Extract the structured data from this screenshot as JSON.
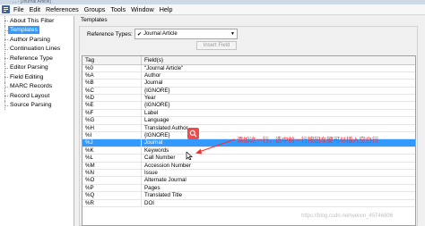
{
  "titlebar": {
    "text": "... - [Journal Article]"
  },
  "menu": {
    "items": [
      "File",
      "Edit",
      "References",
      "Groups",
      "Tools",
      "Window",
      "Help"
    ]
  },
  "sidebar": {
    "items": [
      {
        "label": "About This Filter",
        "selected": false
      },
      {
        "label": "Templates",
        "selected": true
      },
      {
        "label": "Author Parsing",
        "selected": false
      },
      {
        "label": "Continuation Lines",
        "selected": false
      },
      {
        "label": "Reference Type",
        "selected": false
      },
      {
        "label": "Editor Parsing",
        "selected": false
      },
      {
        "label": "Field Editing",
        "selected": false
      },
      {
        "label": "MARC Records",
        "selected": false
      },
      {
        "label": "Record Layout",
        "selected": false
      },
      {
        "label": "Source Parsing",
        "selected": false
      }
    ]
  },
  "panel": {
    "title": "Templates",
    "ref_types_label": "Reference Types:",
    "ref_type_value": "Journal Article",
    "insert_button": "Insert Field"
  },
  "table": {
    "headers": [
      "Tag",
      "Field(s)"
    ],
    "rows": [
      [
        "%0",
        "\"Journal Article\""
      ],
      [
        "%A",
        "Author"
      ],
      [
        "%B",
        "Journal"
      ],
      [
        "%C",
        "{IGNORE}"
      ],
      [
        "%D",
        "Year"
      ],
      [
        "%E",
        "{IGNORE}"
      ],
      [
        "%F",
        "Label"
      ],
      [
        "%G",
        "Language"
      ],
      [
        "%H",
        "Translated Author"
      ],
      [
        "%I",
        "{IGNORE}"
      ],
      [
        "%J",
        "Journal"
      ],
      [
        "%K",
        "Keywords"
      ],
      [
        "%L",
        "Call Number"
      ],
      [
        "%M",
        "Accession Number"
      ],
      [
        "%N",
        "Issue"
      ],
      [
        "%O",
        "Alternate Journal"
      ],
      [
        "%P",
        "Pages"
      ],
      [
        "%Q",
        "Translated Title"
      ],
      [
        "%R",
        "DOI"
      ]
    ],
    "selected_row": 10
  },
  "annotation": {
    "text": "添加这一行，选中前一行按回车键可以插入空白行",
    "color": "#ff2a2a"
  },
  "watermark": "https://blog.csdn.net/weixin_45746806",
  "colors": {
    "selection": "#3399ff",
    "annotation": "#ff2a2a"
  },
  "icons": [
    "app-icon",
    "search-icon",
    "cursor-icon",
    "checkmark-icon",
    "dropdown-arrow-icon"
  ]
}
